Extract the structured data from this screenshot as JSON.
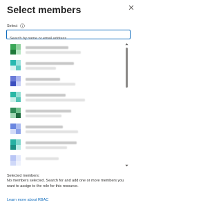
{
  "header": {
    "title": "Select members",
    "close_icon": "close-icon"
  },
  "search": {
    "label": "Select",
    "info_icon": "info-icon",
    "placeholder": "Search by name or email address",
    "value": ""
  },
  "member_list": {
    "items": [
      {
        "colors": [
          "#3aa757",
          "#8fd19e",
          "#1f7a3a",
          "#b5e6c1"
        ]
      },
      {
        "colors": [
          "#28b8b0",
          "#9ae3de",
          "#d8f3f1",
          "#5dc8c1"
        ]
      },
      {
        "colors": [
          "#6b7bd8",
          "#a9b3ee",
          "#3c4fbf",
          "#c9d0f6"
        ]
      },
      {
        "colors": [
          "#29b7a5",
          "#93dfd4",
          "#c9efe9",
          "#52c4b6"
        ]
      },
      {
        "colors": [
          "#2e8a56",
          "#6fbf8c",
          "#9fd6b3",
          "#1e6a3f"
        ]
      },
      {
        "colors": [
          "#6a86e0",
          "#a9baf0",
          "#d4dcf8",
          "#8ea3ea"
        ]
      },
      {
        "colors": [
          "#26b1a3",
          "#7dd6cc",
          "#1a8f83",
          "#b8ebe5"
        ]
      },
      {
        "colors": [
          "#b9c6f5",
          "#e2e8fb",
          "#cfd8f8",
          "#eef1fc"
        ]
      }
    ]
  },
  "scrollbar": {
    "up_icon": "scroll-up-icon",
    "down_icon": "scroll-down-icon"
  },
  "selection": {
    "title": "Selected members:",
    "description": "No members selected. Search for and add one or more members you want to assign to the role for this resource."
  },
  "footer": {
    "link": "Learn more about RBAC"
  }
}
